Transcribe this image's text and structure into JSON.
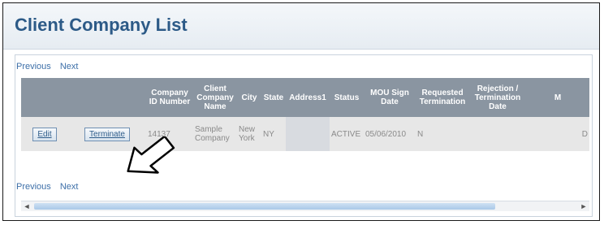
{
  "page": {
    "title": "Client Company List"
  },
  "pager": {
    "previous": "Previous",
    "next": "Next"
  },
  "table": {
    "headers": [
      "",
      "",
      "Company ID Number",
      "Client Company Name",
      "City",
      "State",
      "Address1",
      "Status",
      "MOU Sign Date",
      "Requested Termination",
      "Rejection / Termination Date",
      "M"
    ],
    "row": {
      "edit": "Edit",
      "terminate": "Terminate",
      "company_id": "14137",
      "company_name": "Sample Company",
      "city": "New York",
      "state": "NY",
      "address1": "",
      "status": "ACTIVE",
      "mou_sign_date": "05/06/2010",
      "requested_termination": "N",
      "termination_date": "",
      "extra": "D"
    }
  },
  "scroll": {
    "left_arrow": "◄",
    "right_arrow": "►"
  },
  "colors": {
    "title": "#2c5a87",
    "header_bg": "#8a95a1",
    "link": "#3d6fa8"
  }
}
